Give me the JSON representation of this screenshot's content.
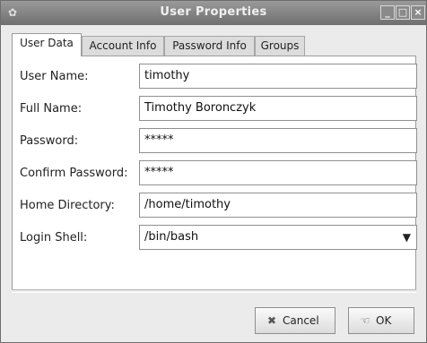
{
  "window": {
    "title": "User Properties"
  },
  "title_buttons": {
    "minimize": "_",
    "maximize": "□",
    "close": "×"
  },
  "tabs": [
    {
      "label": "User Data"
    },
    {
      "label": "Account Info"
    },
    {
      "label": "Password Info"
    },
    {
      "label": "Groups"
    }
  ],
  "form": {
    "user_name_label": "User Name:",
    "user_name_value": "timothy",
    "full_name_label": "Full Name:",
    "full_name_value": "Timothy Boronczyk",
    "password_label": "Password:",
    "password_value": "*****",
    "confirm_label": "Confirm Password:",
    "confirm_value": "*****",
    "home_label": "Home Directory:",
    "home_value": "/home/timothy",
    "shell_label": "Login Shell:",
    "shell_value": "/bin/bash"
  },
  "buttons": {
    "cancel": "Cancel",
    "ok": "OK"
  }
}
